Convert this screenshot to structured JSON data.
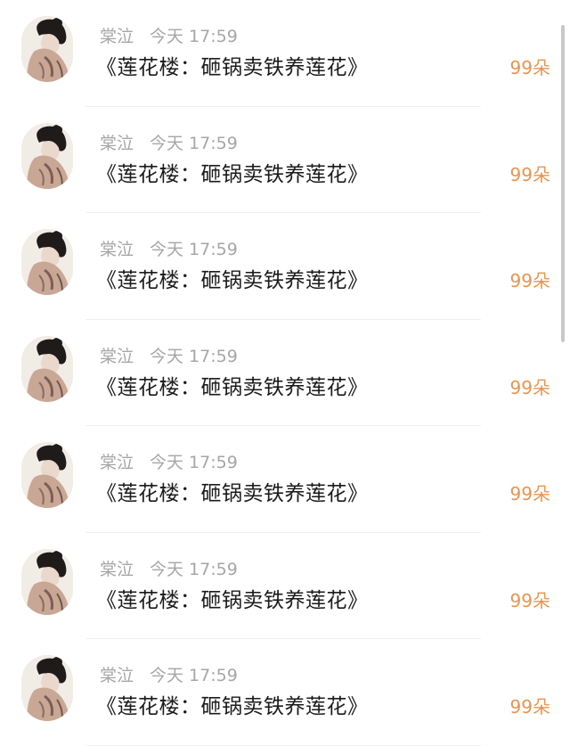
{
  "messages": [
    {
      "sender": "棠泣",
      "time": "今天 17:59",
      "title": "《莲花楼：砸锅卖铁养莲花》",
      "count": "99朵"
    },
    {
      "sender": "棠泣",
      "time": "今天 17:59",
      "title": "《莲花楼：砸锅卖铁养莲花》",
      "count": "99朵"
    },
    {
      "sender": "棠泣",
      "time": "今天 17:59",
      "title": "《莲花楼：砸锅卖铁养莲花》",
      "count": "99朵"
    },
    {
      "sender": "棠泣",
      "time": "今天 17:59",
      "title": "《莲花楼：砸锅卖铁养莲花》",
      "count": "99朵"
    },
    {
      "sender": "棠泣",
      "time": "今天 17:59",
      "title": "《莲花楼：砸锅卖铁养莲花》",
      "count": "99朵"
    },
    {
      "sender": "棠泣",
      "time": "今天 17:59",
      "title": "《莲花楼：砸锅卖铁养莲花》",
      "count": "99朵"
    },
    {
      "sender": "棠泣",
      "time": "今天 17:59",
      "title": "《莲花楼：砸锅卖铁养莲花》",
      "count": "99朵"
    }
  ],
  "colors": {
    "sender": "#a6a6a6",
    "title": "#1a1a1a",
    "count": "#e8944f",
    "divider": "#f0f0f0"
  },
  "icons": {
    "avatar": "user-avatar-photo"
  }
}
